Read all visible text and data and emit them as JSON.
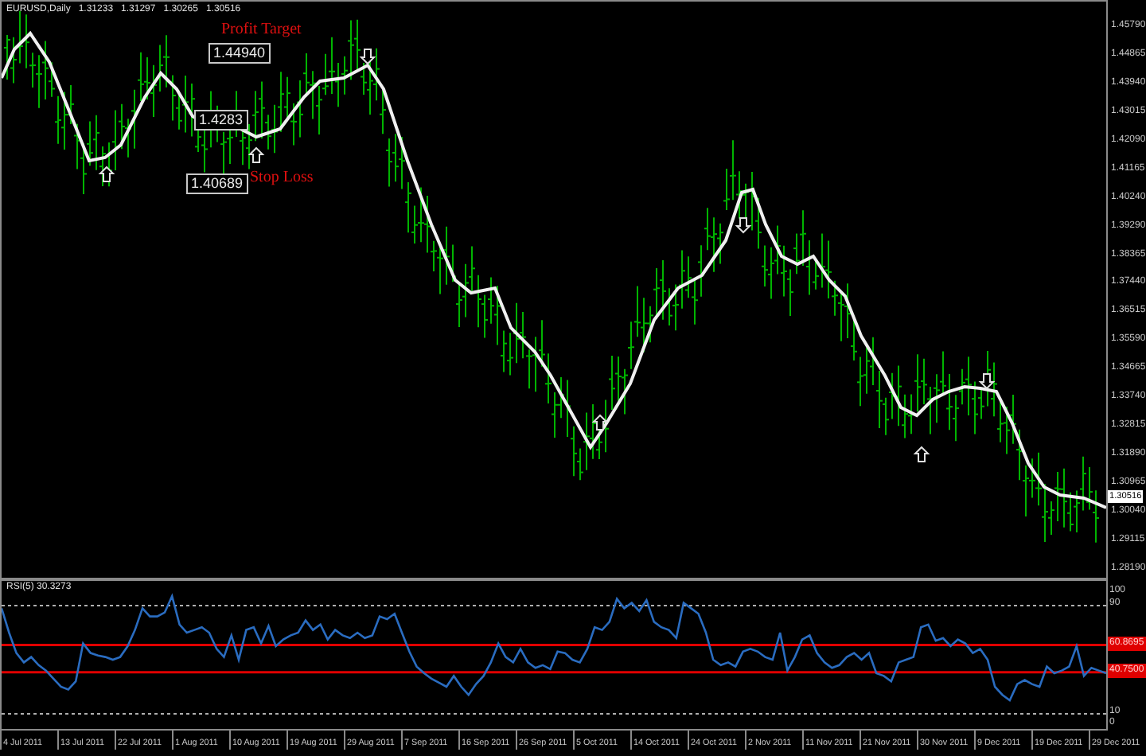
{
  "chart": {
    "header": {
      "symbol": "EURUSD,Daily",
      "values": [
        "1.31233",
        "1.31297",
        "1.30265",
        "1.30516"
      ]
    },
    "annotations": [
      {
        "kind": "target",
        "label": "Profit Target",
        "price": "1.44940"
      },
      {
        "kind": "entry",
        "price": "1.4283"
      },
      {
        "kind": "stop",
        "label": "Stop Loss",
        "price": "1.40689"
      }
    ],
    "price_axis": [
      "1.45790",
      "1.44865",
      "1.43940",
      "1.43015",
      "1.42090",
      "1.41165",
      "1.40240",
      "1.39290",
      "1.38365",
      "1.37440",
      "1.36515",
      "1.35590",
      "1.34665",
      "1.33740",
      "1.32815",
      "1.31890",
      "1.30965",
      "1.30040",
      "1.29115",
      "1.28190"
    ],
    "current_price": "1.30516"
  },
  "rsi": {
    "title": "RSI(5) 30.3273",
    "levels": [
      {
        "label": "100",
        "kind": "plain"
      },
      {
        "label": "90",
        "kind": "dashed"
      },
      {
        "label": "60.8695",
        "kind": "signal"
      },
      {
        "label": "40.7500",
        "kind": "signal"
      },
      {
        "label": "10",
        "kind": "dashed"
      },
      {
        "label": "0",
        "kind": "plain"
      }
    ]
  },
  "date_axis": [
    "4 Jul 2011",
    "13 Jul 2011",
    "22 Jul 2011",
    "1 Aug 2011",
    "10 Aug 2011",
    "19 Aug 2011",
    "29 Aug 2011",
    "7 Sep 2011",
    "16 Sep 2011",
    "26 Sep 2011",
    "5 Oct 2011",
    "14 Oct 2011",
    "24 Oct 2011",
    "2 Nov 2011",
    "11 Nov 2011",
    "21 Nov 2011",
    "30 Nov 2011",
    "9 Dec 2011",
    "19 Dec 2011",
    "29 Dec 2011"
  ]
}
